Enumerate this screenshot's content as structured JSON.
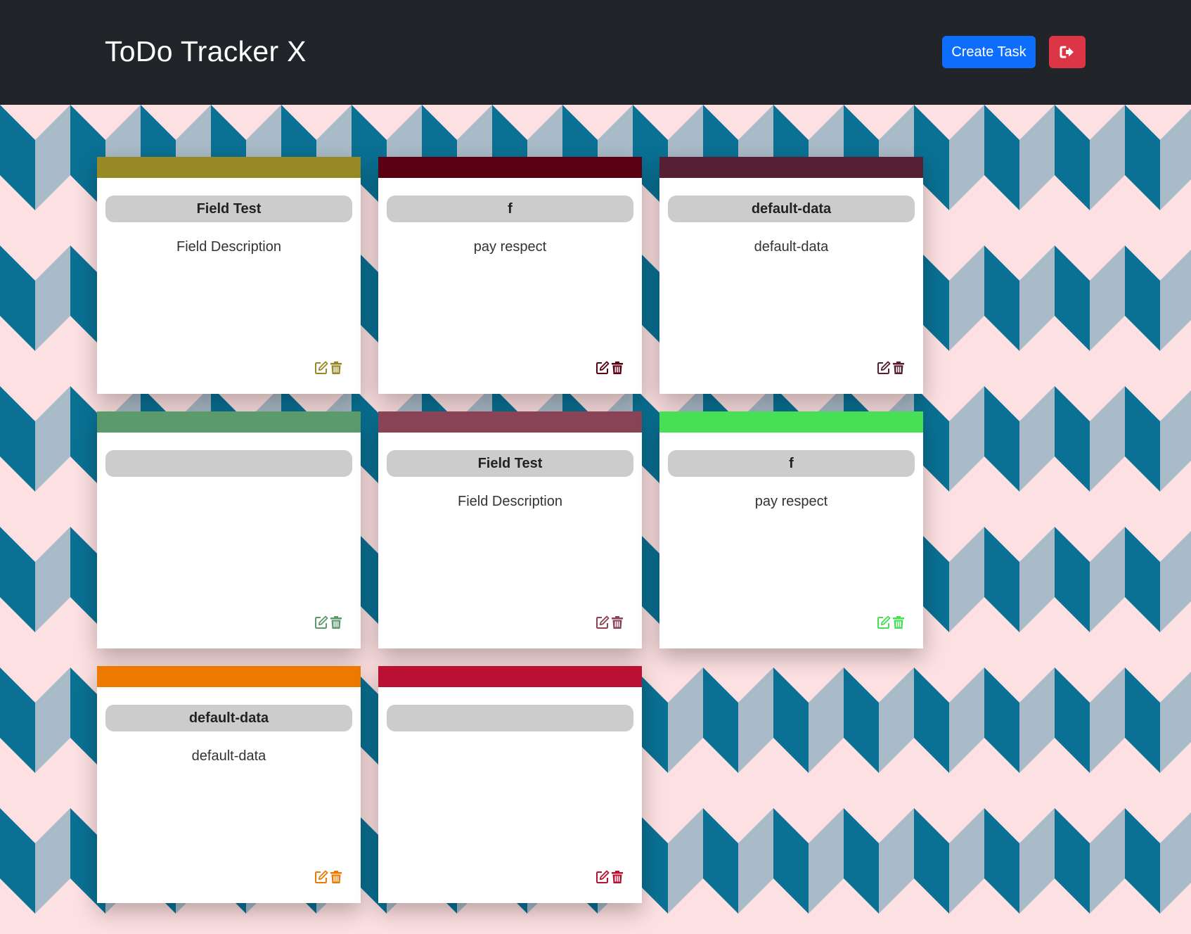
{
  "app": {
    "title": "ToDo Tracker X",
    "create_label": "Create Task",
    "logout_icon": "sign-out-icon",
    "primary_color": "#0d6efd",
    "danger_color": "#dc3545"
  },
  "tasks": [
    {
      "title": "Field Test",
      "description": "Field Description",
      "color": "#998925"
    },
    {
      "title": "f",
      "description": "pay respect",
      "color": "#5b0013"
    },
    {
      "title": "default-data",
      "description": "default-data",
      "color": "#561f33"
    },
    {
      "title": "",
      "description": "",
      "color": "#5b9a6b"
    },
    {
      "title": "Field Test",
      "description": "Field Description",
      "color": "#8a4356"
    },
    {
      "title": "f",
      "description": "pay respect",
      "color": "#46df56"
    },
    {
      "title": "default-data",
      "description": "default-data",
      "color": "#ee7900"
    },
    {
      "title": "",
      "description": "",
      "color": "#ba1033"
    }
  ]
}
